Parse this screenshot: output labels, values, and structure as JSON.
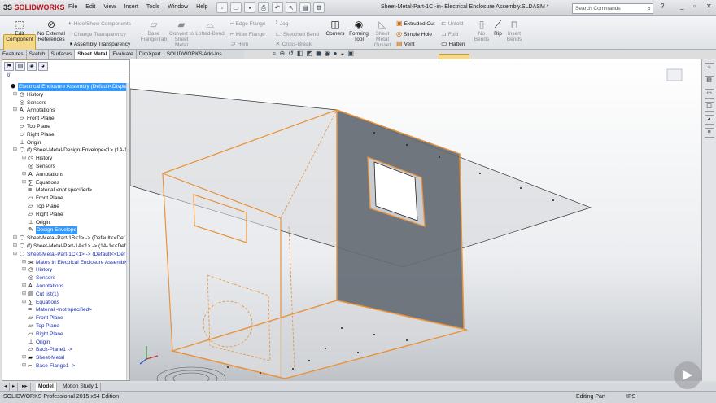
{
  "app": {
    "logo_prefix": "3S",
    "logo_text": "SOLIDWORKS",
    "doc_title": "Sheet-Metal-Part-1C -in- Electrical Enclosure Assembly.SLDASM *"
  },
  "menu": [
    "File",
    "Edit",
    "View",
    "Insert",
    "Tools",
    "Window",
    "Help"
  ],
  "search": {
    "placeholder": "Search Commands",
    "icon": "search-icon"
  },
  "ribbon": {
    "edit_component": "Edit Component",
    "no_external": "No External References",
    "hide_show": "Hide/Show Components",
    "change_transparency": "Change Transparency",
    "assembly_transparency": "Assembly Transparency",
    "base_flange": "Base Flange/Tab",
    "convert_sheet": "Convert to Sheet Metal",
    "lofted_bend": "Lofted-Bend",
    "edge_flange": "Edge Flange",
    "miter_flange": "Miter Flange",
    "hem": "Hem",
    "jog": "Jog",
    "sketched_bend": "Sketched Bend",
    "cross_break": "Cross-Break",
    "corners": "Corners",
    "forming_tool": "Forming Tool",
    "sheet_metal_gusset": "Sheet Metal Gusset",
    "extruded_cut": "Extruded Cut",
    "simple_hole": "Simple Hole",
    "vent": "Vent",
    "unfold": "Unfold",
    "fold": "Fold",
    "flatten": "Flatten",
    "no_bends": "No Bends",
    "rip": "Rip",
    "insert_bends": "Insert Bends"
  },
  "tabs": [
    "Features",
    "Sketch",
    "Surfaces",
    "Sheet Metal",
    "Evaluate",
    "DimXpert",
    "SOLIDWORKS Add-Ins"
  ],
  "active_tab": "Sheet Metal",
  "tree": [
    {
      "label": "Electrical Enclosure Assembly  (Default<Displa",
      "depth": 0,
      "icon": "assembly-icon",
      "toggle": "",
      "state": "sel"
    },
    {
      "label": "History",
      "depth": 1,
      "icon": "history-icon",
      "toggle": "+",
      "state": ""
    },
    {
      "label": "Sensors",
      "depth": 1,
      "icon": "sensors-icon",
      "toggle": "",
      "state": ""
    },
    {
      "label": "Annotations",
      "depth": 1,
      "icon": "annotations-icon",
      "toggle": "+",
      "state": ""
    },
    {
      "label": "Front Plane",
      "depth": 1,
      "icon": "plane-icon",
      "toggle": "",
      "state": ""
    },
    {
      "label": "Top Plane",
      "depth": 1,
      "icon": "plane-icon",
      "toggle": "",
      "state": ""
    },
    {
      "label": "Right Plane",
      "depth": 1,
      "icon": "plane-icon",
      "toggle": "",
      "state": ""
    },
    {
      "label": "Origin",
      "depth": 1,
      "icon": "origin-icon",
      "toggle": "",
      "state": ""
    },
    {
      "label": "(f) Sheet-Metal-Design-Envelope<1> (1A-1",
      "depth": 1,
      "icon": "part-icon",
      "toggle": "-",
      "state": ""
    },
    {
      "label": "History",
      "depth": 2,
      "icon": "history-icon",
      "toggle": "+",
      "state": ""
    },
    {
      "label": "Sensors",
      "depth": 2,
      "icon": "sensors-icon",
      "toggle": "",
      "state": ""
    },
    {
      "label": "Annotations",
      "depth": 2,
      "icon": "annotations-icon",
      "toggle": "+",
      "state": ""
    },
    {
      "label": "Equations",
      "depth": 2,
      "icon": "equations-icon",
      "toggle": "+",
      "state": ""
    },
    {
      "label": "Material <not specified>",
      "depth": 2,
      "icon": "material-icon",
      "toggle": "",
      "state": ""
    },
    {
      "label": "Front Plane",
      "depth": 2,
      "icon": "plane-icon",
      "toggle": "",
      "state": ""
    },
    {
      "label": "Top Plane",
      "depth": 2,
      "icon": "plane-icon",
      "toggle": "",
      "state": ""
    },
    {
      "label": "Right Plane",
      "depth": 2,
      "icon": "plane-icon",
      "toggle": "",
      "state": ""
    },
    {
      "label": "Origin",
      "depth": 2,
      "icon": "origin-icon",
      "toggle": "",
      "state": ""
    },
    {
      "label": "Design Envelope",
      "depth": 2,
      "icon": "sketch-icon",
      "toggle": "",
      "state": "sel"
    },
    {
      "label": "Sheet-Metal-Part-1B<1> -> (Default<<Def",
      "depth": 1,
      "icon": "part-icon",
      "toggle": "+",
      "state": ""
    },
    {
      "label": "(f) Sheet-Metal-Part-1A<1> -> (1A-1<<Def",
      "depth": 1,
      "icon": "part-icon",
      "toggle": "+",
      "state": ""
    },
    {
      "label": "Sheet-Metal-Part-1C<1> -> (Default<<Def",
      "depth": 1,
      "icon": "part-icon",
      "toggle": "-",
      "state": "blue"
    },
    {
      "label": "Mates in Electrical Enclosure Assembly",
      "depth": 2,
      "icon": "mates-icon",
      "toggle": "+",
      "state": "blue"
    },
    {
      "label": "History",
      "depth": 2,
      "icon": "history-icon",
      "toggle": "+",
      "state": "blue"
    },
    {
      "label": "Sensors",
      "depth": 2,
      "icon": "sensors-icon",
      "toggle": "",
      "state": "blue"
    },
    {
      "label": "Annotations",
      "depth": 2,
      "icon": "annotations-icon",
      "toggle": "+",
      "state": "blue"
    },
    {
      "label": "Cut list(1)",
      "depth": 2,
      "icon": "cutlist-icon",
      "toggle": "+",
      "state": "blue"
    },
    {
      "label": "Equations",
      "depth": 2,
      "icon": "equations-icon",
      "toggle": "+",
      "state": "blue"
    },
    {
      "label": "Material <not specified>",
      "depth": 2,
      "icon": "material-icon",
      "toggle": "",
      "state": "blue"
    },
    {
      "label": "Front Plane",
      "depth": 2,
      "icon": "plane-icon",
      "toggle": "",
      "state": "blue"
    },
    {
      "label": "Top Plane",
      "depth": 2,
      "icon": "plane-icon",
      "toggle": "",
      "state": "blue"
    },
    {
      "label": "Right Plane",
      "depth": 2,
      "icon": "plane-icon",
      "toggle": "",
      "state": "blue"
    },
    {
      "label": "Origin",
      "depth": 2,
      "icon": "origin-icon",
      "toggle": "",
      "state": "blue"
    },
    {
      "label": "Back-Plane1 ->",
      "depth": 2,
      "icon": "plane-icon",
      "toggle": "",
      "state": "blue"
    },
    {
      "label": "Sheet-Metal",
      "depth": 2,
      "icon": "sheetmetal-icon",
      "toggle": "+",
      "state": "blue"
    },
    {
      "label": "Base-Flange1 ->",
      "depth": 2,
      "icon": "flange-icon",
      "toggle": "+",
      "state": "blue"
    }
  ],
  "bottom_tabs": [
    "Model",
    "Motion Study 1"
  ],
  "status": {
    "edition": "SOLIDWORKS Professional 2015 x64 Edition",
    "mode": "Editing Part",
    "units": "IPS"
  },
  "colors": {
    "accent_orange": "#e8923a",
    "selection_blue": "#3399ff",
    "panel_gray": "#666d75"
  }
}
